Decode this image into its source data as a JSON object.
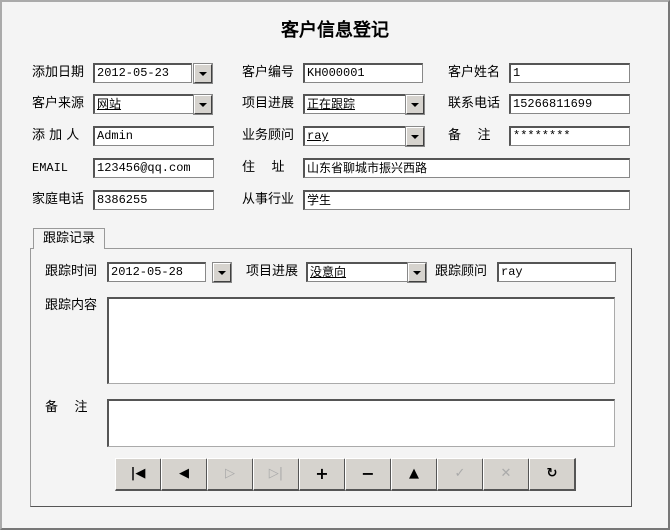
{
  "title": "客户信息登记",
  "fields": {
    "add_date": {
      "label": "添加日期",
      "value": "2012-05-23"
    },
    "customer_no": {
      "label": "客户编号",
      "value": "KH000001"
    },
    "customer_name": {
      "label": "客户姓名",
      "value": "1"
    },
    "source": {
      "label": "客户来源",
      "value": "网站"
    },
    "progress": {
      "label": "项目进展",
      "value": "正在跟踪"
    },
    "phone": {
      "label": "联系电话",
      "value": "15266811699"
    },
    "added_by": {
      "label": "添 加 人",
      "value": "Admin"
    },
    "consultant": {
      "label": "业务顾问",
      "value": "ray"
    },
    "remark": {
      "label": "备    注",
      "value": "********"
    },
    "email": {
      "label": "EMAIL",
      "value": "123456@qq.com"
    },
    "address": {
      "label": "住    址",
      "value": "山东省聊城市振兴西路"
    },
    "home_phone": {
      "label": "家庭电话",
      "value": "8386255"
    },
    "industry": {
      "label": "从事行业",
      "value": "学生"
    }
  },
  "tab": {
    "label": "跟踪记录"
  },
  "follow": {
    "time": {
      "label": "跟踪时间",
      "value": "2012-05-28"
    },
    "progress": {
      "label": "项目进展",
      "value": "没意向"
    },
    "consultant": {
      "label": "跟踪顾问",
      "value": "ray"
    },
    "content": {
      "label": "跟踪内容",
      "value": ""
    },
    "remark": {
      "label": "备    注",
      "value": ""
    }
  },
  "navigator": [
    "first",
    "prior",
    "next",
    "last",
    "insert",
    "delete",
    "edit",
    "post",
    "cancel",
    "refresh"
  ]
}
